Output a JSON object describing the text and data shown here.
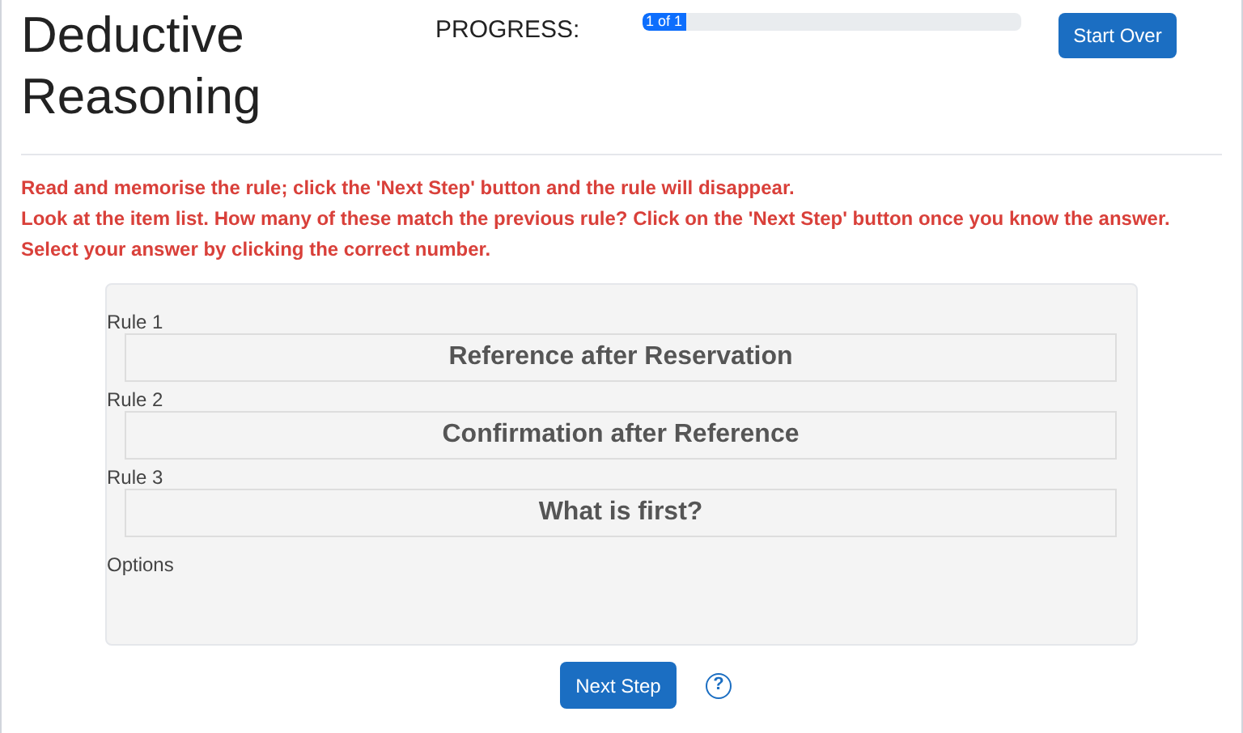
{
  "title": "Deductive Reasoning",
  "progress": {
    "label": "PROGRESS:",
    "text": "1 of 1",
    "level": 0.1
  },
  "start_over": "Start Over",
  "instructions": [
    "Read and memorise the rule; click the 'Next Step' button and the rule will disappear.",
    "Look at the item list. How many of these match the previous rule? Click on the 'Next Step' button once you know the answer.",
    "Select your answer by clicking the correct number."
  ],
  "rules": [
    {
      "label": "Rule 1",
      "text": "Reference after Reservation"
    },
    {
      "label": "Rule 2",
      "text": "Confirmation after Reference"
    },
    {
      "label": "Rule 3",
      "text": "What is first?"
    }
  ],
  "options_label": "Options",
  "next_step": "Next Step",
  "help": "?"
}
